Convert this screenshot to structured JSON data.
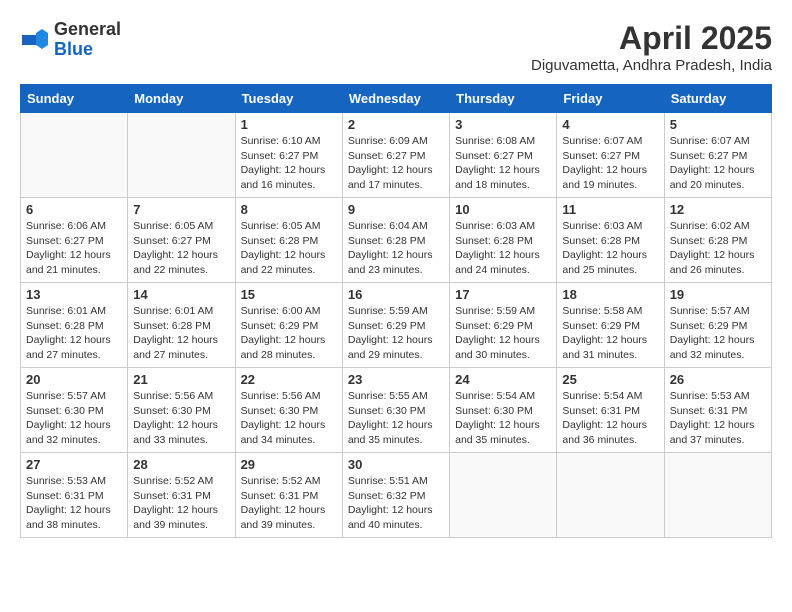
{
  "header": {
    "logo_general": "General",
    "logo_blue": "Blue",
    "title": "April 2025",
    "subtitle": "Diguvametta, Andhra Pradesh, India"
  },
  "weekdays": [
    "Sunday",
    "Monday",
    "Tuesday",
    "Wednesday",
    "Thursday",
    "Friday",
    "Saturday"
  ],
  "weeks": [
    [
      {
        "day": null,
        "info": null
      },
      {
        "day": null,
        "info": null
      },
      {
        "day": "1",
        "info": "Sunrise: 6:10 AM\nSunset: 6:27 PM\nDaylight: 12 hours\nand 16 minutes."
      },
      {
        "day": "2",
        "info": "Sunrise: 6:09 AM\nSunset: 6:27 PM\nDaylight: 12 hours\nand 17 minutes."
      },
      {
        "day": "3",
        "info": "Sunrise: 6:08 AM\nSunset: 6:27 PM\nDaylight: 12 hours\nand 18 minutes."
      },
      {
        "day": "4",
        "info": "Sunrise: 6:07 AM\nSunset: 6:27 PM\nDaylight: 12 hours\nand 19 minutes."
      },
      {
        "day": "5",
        "info": "Sunrise: 6:07 AM\nSunset: 6:27 PM\nDaylight: 12 hours\nand 20 minutes."
      }
    ],
    [
      {
        "day": "6",
        "info": "Sunrise: 6:06 AM\nSunset: 6:27 PM\nDaylight: 12 hours\nand 21 minutes."
      },
      {
        "day": "7",
        "info": "Sunrise: 6:05 AM\nSunset: 6:27 PM\nDaylight: 12 hours\nand 22 minutes."
      },
      {
        "day": "8",
        "info": "Sunrise: 6:05 AM\nSunset: 6:28 PM\nDaylight: 12 hours\nand 22 minutes."
      },
      {
        "day": "9",
        "info": "Sunrise: 6:04 AM\nSunset: 6:28 PM\nDaylight: 12 hours\nand 23 minutes."
      },
      {
        "day": "10",
        "info": "Sunrise: 6:03 AM\nSunset: 6:28 PM\nDaylight: 12 hours\nand 24 minutes."
      },
      {
        "day": "11",
        "info": "Sunrise: 6:03 AM\nSunset: 6:28 PM\nDaylight: 12 hours\nand 25 minutes."
      },
      {
        "day": "12",
        "info": "Sunrise: 6:02 AM\nSunset: 6:28 PM\nDaylight: 12 hours\nand 26 minutes."
      }
    ],
    [
      {
        "day": "13",
        "info": "Sunrise: 6:01 AM\nSunset: 6:28 PM\nDaylight: 12 hours\nand 27 minutes."
      },
      {
        "day": "14",
        "info": "Sunrise: 6:01 AM\nSunset: 6:28 PM\nDaylight: 12 hours\nand 27 minutes."
      },
      {
        "day": "15",
        "info": "Sunrise: 6:00 AM\nSunset: 6:29 PM\nDaylight: 12 hours\nand 28 minutes."
      },
      {
        "day": "16",
        "info": "Sunrise: 5:59 AM\nSunset: 6:29 PM\nDaylight: 12 hours\nand 29 minutes."
      },
      {
        "day": "17",
        "info": "Sunrise: 5:59 AM\nSunset: 6:29 PM\nDaylight: 12 hours\nand 30 minutes."
      },
      {
        "day": "18",
        "info": "Sunrise: 5:58 AM\nSunset: 6:29 PM\nDaylight: 12 hours\nand 31 minutes."
      },
      {
        "day": "19",
        "info": "Sunrise: 5:57 AM\nSunset: 6:29 PM\nDaylight: 12 hours\nand 32 minutes."
      }
    ],
    [
      {
        "day": "20",
        "info": "Sunrise: 5:57 AM\nSunset: 6:30 PM\nDaylight: 12 hours\nand 32 minutes."
      },
      {
        "day": "21",
        "info": "Sunrise: 5:56 AM\nSunset: 6:30 PM\nDaylight: 12 hours\nand 33 minutes."
      },
      {
        "day": "22",
        "info": "Sunrise: 5:56 AM\nSunset: 6:30 PM\nDaylight: 12 hours\nand 34 minutes."
      },
      {
        "day": "23",
        "info": "Sunrise: 5:55 AM\nSunset: 6:30 PM\nDaylight: 12 hours\nand 35 minutes."
      },
      {
        "day": "24",
        "info": "Sunrise: 5:54 AM\nSunset: 6:30 PM\nDaylight: 12 hours\nand 35 minutes."
      },
      {
        "day": "25",
        "info": "Sunrise: 5:54 AM\nSunset: 6:31 PM\nDaylight: 12 hours\nand 36 minutes."
      },
      {
        "day": "26",
        "info": "Sunrise: 5:53 AM\nSunset: 6:31 PM\nDaylight: 12 hours\nand 37 minutes."
      }
    ],
    [
      {
        "day": "27",
        "info": "Sunrise: 5:53 AM\nSunset: 6:31 PM\nDaylight: 12 hours\nand 38 minutes."
      },
      {
        "day": "28",
        "info": "Sunrise: 5:52 AM\nSunset: 6:31 PM\nDaylight: 12 hours\nand 39 minutes."
      },
      {
        "day": "29",
        "info": "Sunrise: 5:52 AM\nSunset: 6:31 PM\nDaylight: 12 hours\nand 39 minutes."
      },
      {
        "day": "30",
        "info": "Sunrise: 5:51 AM\nSunset: 6:32 PM\nDaylight: 12 hours\nand 40 minutes."
      },
      {
        "day": null,
        "info": null
      },
      {
        "day": null,
        "info": null
      },
      {
        "day": null,
        "info": null
      }
    ]
  ]
}
